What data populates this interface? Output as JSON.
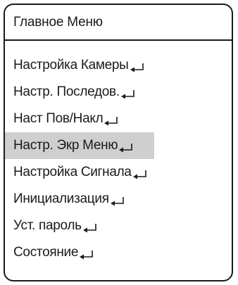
{
  "menu": {
    "title": "Главное Меню",
    "items": [
      {
        "label": "Настройка Камеры",
        "icon": "enter-icon"
      },
      {
        "label": "Настр. Последов.",
        "icon": "enter-icon"
      },
      {
        "label": "Наст Пов/Накл",
        "icon": "enter-icon"
      },
      {
        "label": "Настр. Экр Меню",
        "icon": "enter-icon",
        "selected": true
      },
      {
        "label": "Настройка Сигнала",
        "icon": "enter-icon"
      },
      {
        "label": "Инициализация",
        "icon": "enter-icon"
      },
      {
        "label": "Уст. пароль",
        "icon": "enter-icon"
      },
      {
        "label": "Состояние",
        "icon": "enter-icon"
      }
    ],
    "colors": {
      "border": "#1a1a1a",
      "highlight": "#cfcfcf"
    }
  }
}
